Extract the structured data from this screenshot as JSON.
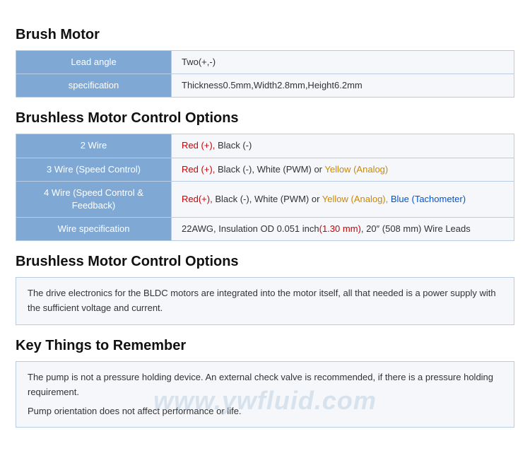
{
  "sections": {
    "brush_motor": {
      "title": "Brush Motor",
      "rows": [
        {
          "label": "Lead angle",
          "value": "Two(+,-)"
        },
        {
          "label": "specification",
          "value": "Thickness0.5mm,Width2.8mm,Height6.2mm"
        }
      ]
    },
    "brushless_control_options": {
      "title": "Brushless Motor Control Options",
      "rows": [
        {
          "label": "2 Wire",
          "value_parts": [
            {
              "text": "Red (+), ",
              "color": "red"
            },
            {
              "text": "Black (-)",
              "color": "dark"
            }
          ]
        },
        {
          "label": "3 Wire (Speed Control)",
          "value_parts": [
            {
              "text": "Red (+), ",
              "color": "red"
            },
            {
              "text": "Black (-), ",
              "color": "dark"
            },
            {
              "text": "White (PWM) ",
              "color": "dark"
            },
            {
              "text": "or ",
              "color": "dark"
            },
            {
              "text": "Yellow (Analog)",
              "color": "orange"
            }
          ]
        },
        {
          "label": "4 Wire (Speed Control & Feedback)",
          "value_parts": [
            {
              "text": "Red(+), ",
              "color": "red"
            },
            {
              "text": "Black (-), ",
              "color": "dark"
            },
            {
              "text": "White (PWM) ",
              "color": "dark"
            },
            {
              "text": "or ",
              "color": "dark"
            },
            {
              "text": "Yellow (Analog), ",
              "color": "orange"
            },
            {
              "text": "Blue (Tachometer)",
              "color": "blue"
            }
          ]
        },
        {
          "label": "Wire specification",
          "value_parts": [
            {
              "text": "22AWG, Insulation OD 0.051 inch",
              "color": "dark"
            },
            {
              "text": "(1.30 mm)",
              "color": "red"
            },
            {
              "text": ", 20\" (508 mm) Wire Leads",
              "color": "dark"
            }
          ]
        }
      ]
    },
    "brushless_description": {
      "title": "Brushless Motor Control Options",
      "text": "The drive electronics for the BLDC motors are integrated into the motor itself, all that needed is a power supply with the sufficient voltage and current."
    },
    "key_things": {
      "title": "Key Things to Remember",
      "lines": [
        "The pump is not a pressure holding device. An external check valve is recommended, if there is a pressure holding requirement.",
        "Pump orientation does not affect performance or life."
      ]
    }
  },
  "watermark": "www.ywfluid.com"
}
